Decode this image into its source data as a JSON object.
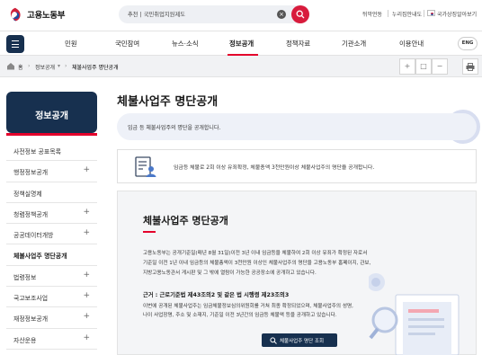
{
  "header": {
    "logo_text": "고용노동부",
    "search": {
      "value": "추천 | 국민취업지원제도"
    },
    "util_links": [
      "뒤막언동",
      "누리집안내도",
      "국가상징알아보기"
    ]
  },
  "gnb": {
    "items": [
      "민원",
      "국민참여",
      "뉴스·소식",
      "정보공개",
      "정책자료",
      "기관소개",
      "이용안내"
    ],
    "active": "정보공개",
    "lang_label": "ENG"
  },
  "breadcrumb": {
    "home_label": "홈",
    "items": [
      "정보공개",
      "체불사업주 명단공개"
    ]
  },
  "sidebar": {
    "title": "정보공개",
    "items": [
      {
        "label": "사전정보 공표목록",
        "expandable": false
      },
      {
        "label": "행정정보공개",
        "expandable": true
      },
      {
        "label": "정책실명제",
        "expandable": false
      },
      {
        "label": "청렴정책공개",
        "expandable": true
      },
      {
        "label": "공공데이터개방",
        "expandable": true
      },
      {
        "label": "체불사업주 명단공개",
        "expandable": false,
        "active": true
      },
      {
        "label": "법령정보",
        "expandable": true
      },
      {
        "label": "국고보조사업",
        "expandable": true
      },
      {
        "label": "재정정보공개",
        "expandable": true
      },
      {
        "label": "자산운용",
        "expandable": true
      }
    ]
  },
  "main": {
    "title": "체불사업주 명단공개",
    "description": "임금 등 체불사업주의 명단을 공개합니다.",
    "info_text": "임금등 체불로 2회 이상 유죄확정, 체불총액 3천만원이상 체불사업주의 명단을 공개합니다.",
    "panel": {
      "title": "체불사업주 명단공개",
      "paragraph_lines": [
        "고용노동부는 공개기준일(매년 8월 31일)이전 3년 이내 임금등을 체불하여 2회 이상 유죄가 확정된 자로서",
        "기준일 이전 1년 이내 임금등의 체불총액이 3천만원 이상인 체불사업주의 명단을 고용노동부 홈페이지, 관보,",
        "지방고용노동관서 게시판 및 그 밖에 열람이 가능한 공공장소에 공개하고 있습니다."
      ],
      "law_title": "근거 : 근로기준법 제43조의2 및 같은 법 시행령 제23조의3",
      "law_lines": [
        "이번에 공개된 체불사업주는 임금체불정보심의위원회를 거쳐 최종 확정되었으며, 체불사업주의 성명,",
        "나이 사업장명, 주소 및 소재지, 기준일 이전 3년간의 임금등 체불액 등을 공개하고 있습니다."
      ],
      "lookup_button": "체불사업주 명단 조회"
    }
  },
  "colors": {
    "navy": "#17304f",
    "red": "#e4002b",
    "search_red": "#d81b3c"
  }
}
